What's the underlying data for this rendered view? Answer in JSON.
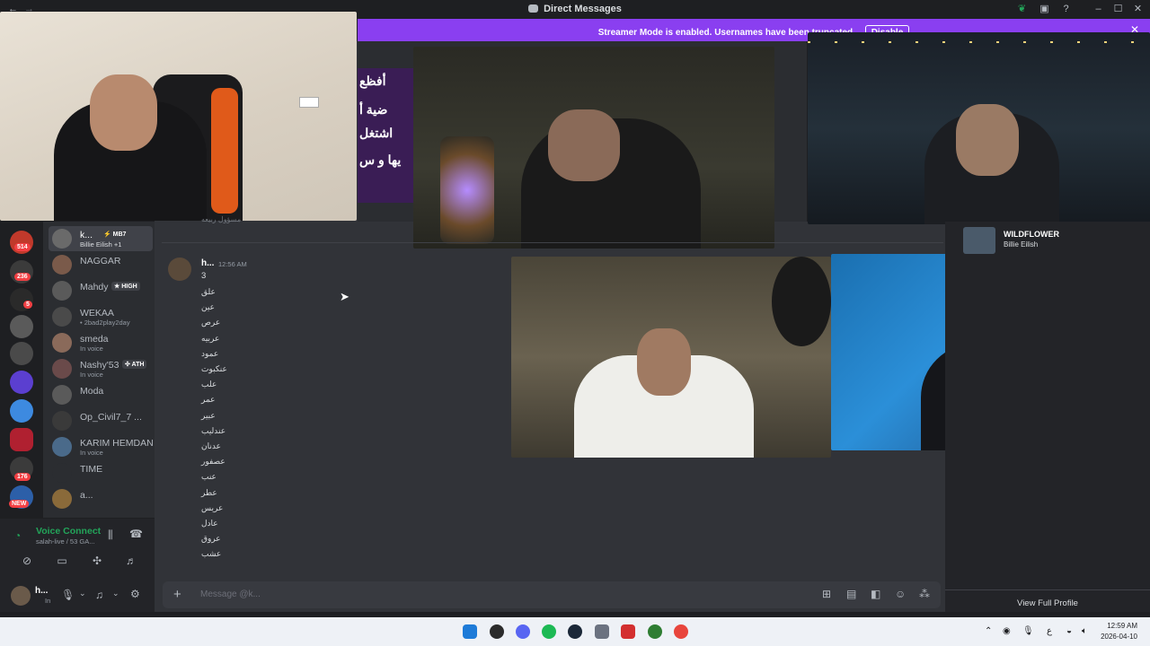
{
  "window": {
    "title": "Direct Messages"
  },
  "banner": {
    "text": "Streamer Mode is enabled. Usernames have been truncated.",
    "button": "Disable"
  },
  "guilds": {
    "badges": [
      "514",
      "236",
      "5",
      "176",
      "NEW"
    ]
  },
  "dm_list": [
    {
      "name": "k...",
      "tag": "⚡ MB7",
      "sub": "Billie Eilish +1",
      "active": true
    },
    {
      "name": "NAGGAR",
      "tag": "",
      "sub": ""
    },
    {
      "name": "Mahdy",
      "tag": "★ HIGH",
      "sub": ""
    },
    {
      "name": "WEKAA",
      "tag": "",
      "sub": "• 2bad2play2day"
    },
    {
      "name": "smeda",
      "tag": "",
      "sub": "In voice"
    },
    {
      "name": "Nashy'53",
      "tag": "✣ ATH",
      "sub": "In voice"
    },
    {
      "name": "Moda",
      "tag": "",
      "sub": ""
    },
    {
      "name": "Op_Civil7_7 ...",
      "tag": "",
      "sub": ""
    },
    {
      "name": "KARIM HEMDAN",
      "tag": "",
      "sub": "In voice"
    },
    {
      "name": "TIME",
      "tag": "",
      "sub": ""
    },
    {
      "name": "a...",
      "tag": "",
      "sub": ""
    }
  ],
  "voice": {
    "status": "Voice Connected",
    "channel": "salah-live / 53 GA..."
  },
  "user": {
    "name": "h...",
    "status": "In"
  },
  "message": {
    "author": "h...",
    "time": "12:56 AM",
    "first_line": "3",
    "words": [
      "علق",
      "عين",
      "عرص",
      "عربيه",
      "عمود",
      "عنكبوت",
      "علب",
      "عمر",
      "عبير",
      "عندليب",
      "عدنان",
      "عصفور",
      "عنب",
      "عطر",
      "عريس",
      "عادل",
      "عروق",
      "عشب"
    ],
    "clipped_line": "مسؤول ربيعه"
  },
  "composer": {
    "placeholder": "Message @k..."
  },
  "right_panel": {
    "activity_title": "WILDFLOWER",
    "activity_artist": "Billie Eilish",
    "view_profile": "View Full Profile"
  },
  "overlay_text": {
    "arabic_lines": [
      "أفظع",
      "ضية أ",
      "اشتغل",
      "يها و س"
    ]
  },
  "clock": {
    "time": "12:59 AM",
    "date": "2026-04-10"
  },
  "tray": {
    "lang": "ع"
  },
  "colors": {
    "accent": "#8a3ff0",
    "online": "#23a55a",
    "dnd": "#f23f43",
    "voice_green": "#23a55a"
  }
}
